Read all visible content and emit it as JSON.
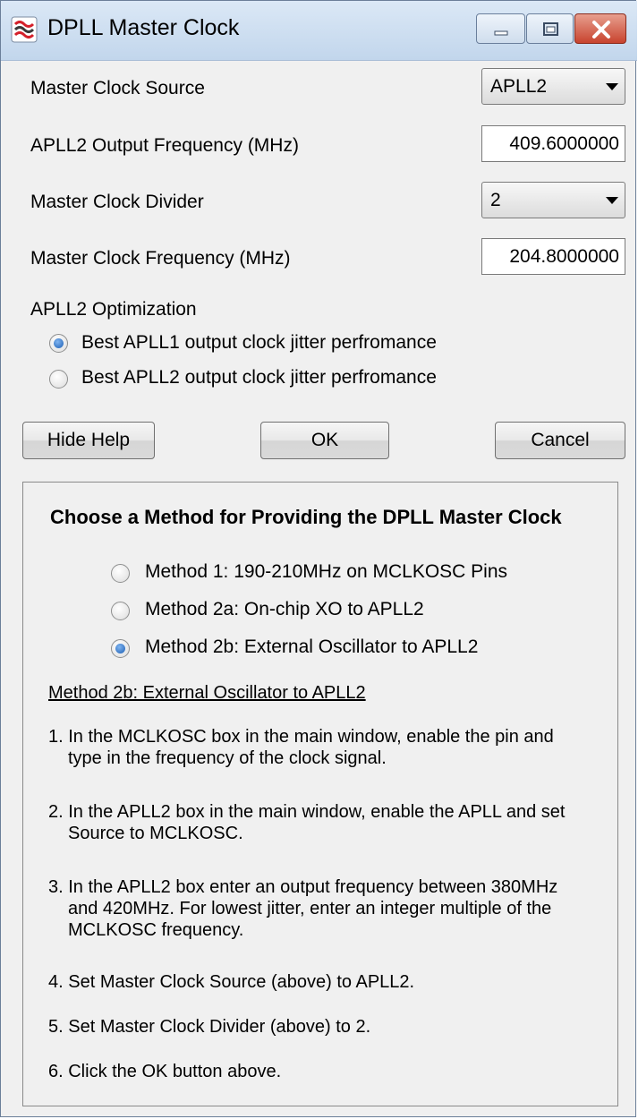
{
  "window": {
    "title": "DPLL Master Clock",
    "icon": "texas-instruments-app-icon",
    "controls": [
      "minimize-icon",
      "maximize-icon",
      "close-icon"
    ]
  },
  "form": {
    "master_clock_source": {
      "label": "Master Clock Source",
      "value": "APLL2"
    },
    "apll2_output_freq": {
      "label": "APLL2 Output Frequency (MHz)",
      "value": "409.6000000"
    },
    "master_clock_divider": {
      "label": "Master Clock Divider",
      "value": "2"
    },
    "master_clock_freq": {
      "label": "Master Clock Frequency (MHz)",
      "value": "204.8000000"
    }
  },
  "optimization": {
    "label": "APLL2 Optimization",
    "options": [
      {
        "label": "Best APLL1 output clock jitter perfromance",
        "checked": true
      },
      {
        "label": "Best APLL2 output clock jitter perfromance",
        "checked": false
      }
    ]
  },
  "buttons": {
    "hide_help": "Hide Help",
    "ok": "OK",
    "cancel": "Cancel"
  },
  "help": {
    "title": "Choose a Method for Providing the DPLL Master Clock",
    "methods": [
      {
        "label": "Method 1: 190-210MHz on MCLKOSC Pins",
        "checked": false
      },
      {
        "label": "Method 2a: On-chip XO to APLL2",
        "checked": false
      },
      {
        "label": "Method 2b: External Oscillator to APLL2",
        "checked": true
      }
    ],
    "subtitle": "Method 2b: External Oscillator to APLL2",
    "steps": [
      {
        "first": "1. In the MCLKOSC box in the main window, enable the pin and",
        "rest": "type in the frequency of the clock signal."
      },
      {
        "first": "2. In the APLL2 box in the main window, enable the APLL and set",
        "rest": "Source to MCLKOSC."
      },
      {
        "first": "3. In the APLL2 box enter an output frequency between 380MHz",
        "rest": "and 420MHz. For lowest jitter, enter an integer multiple of the",
        "rest2": "MCLKOSC frequency."
      },
      {
        "first": "4. Set Master Clock Source (above) to APLL2."
      },
      {
        "first": "5. Set Master Clock Divider (above) to 2."
      },
      {
        "first": "6. Click the OK button above."
      }
    ]
  },
  "colors": {
    "titlebar": "#c2d6ec",
    "close_button": "#c8432e",
    "radio_selected": "#1d5fb4",
    "window_bg": "#f0f0f0"
  }
}
